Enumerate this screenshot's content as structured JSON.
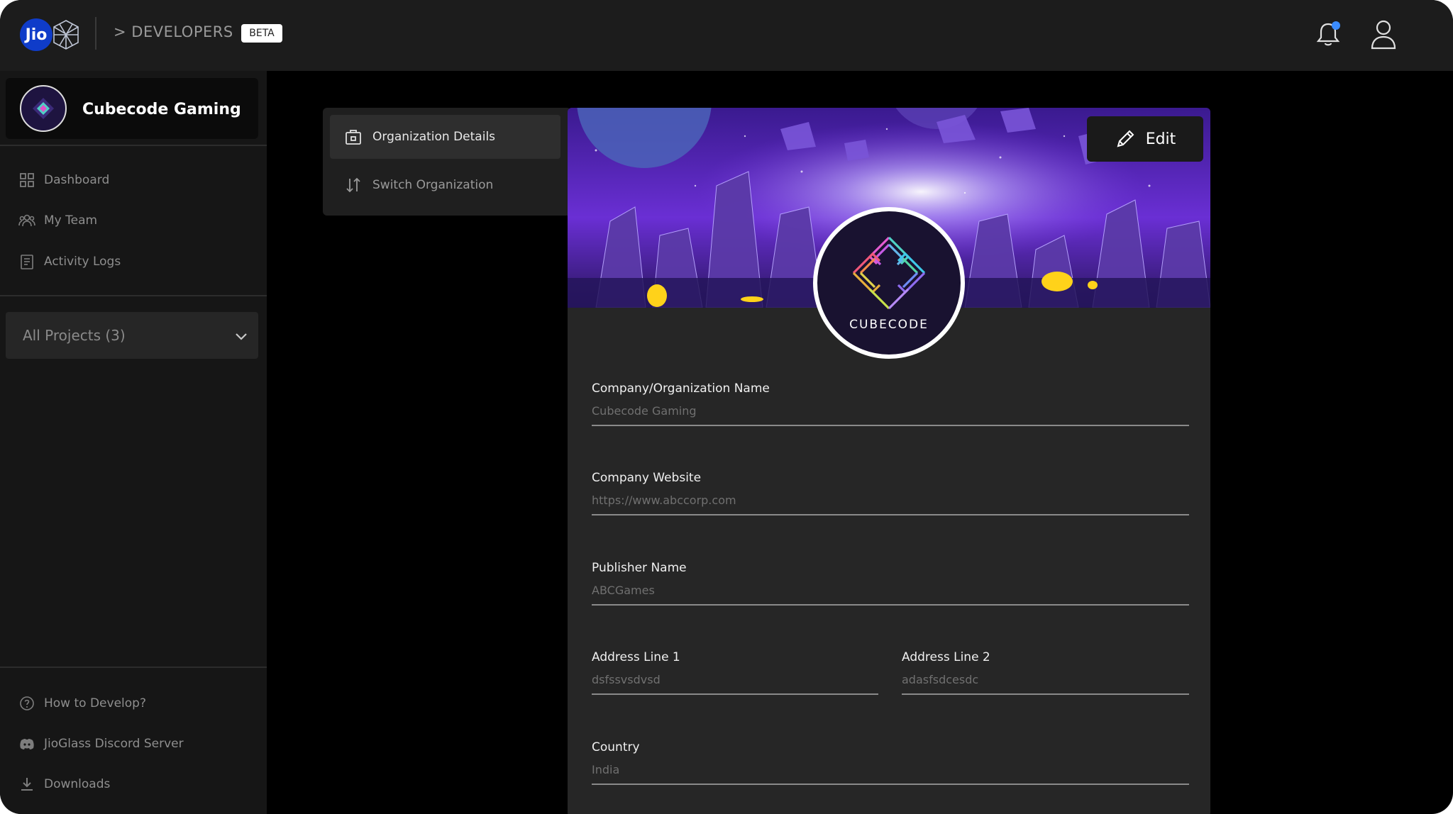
{
  "topbar": {
    "brand_text": "Jio",
    "developers_label": "> DEVELOPERS",
    "beta_label": "BETA"
  },
  "sidebar": {
    "org_name": "Cubecode Gaming",
    "nav_items": [
      {
        "label": "Dashboard",
        "icon": "grid-icon"
      },
      {
        "label": "My Team",
        "icon": "team-icon"
      },
      {
        "label": "Activity Logs",
        "icon": "clipboard-icon"
      }
    ],
    "projects_select": {
      "value": "All Projects (3)"
    },
    "footer_items": [
      {
        "label": "How to Develop?",
        "icon": "help-icon"
      },
      {
        "label": "JioGlass Discord Server",
        "icon": "discord-icon"
      },
      {
        "label": "Downloads",
        "icon": "download-icon"
      }
    ]
  },
  "submenu": {
    "items": [
      {
        "label": "Organization Details",
        "icon": "briefcase-icon",
        "active": true
      },
      {
        "label": "Switch Organization",
        "icon": "swap-icon",
        "active": false
      }
    ]
  },
  "panel": {
    "edit_label": "Edit",
    "logo_wordmark": "CUBECODE",
    "fields": {
      "company_name": {
        "label": "Company/Organization Name",
        "value": "Cubecode Gaming"
      },
      "company_website": {
        "label": "Company Website",
        "value": "https://www.abccorp.com"
      },
      "publisher_name": {
        "label": "Publisher Name",
        "value": "ABCGames"
      },
      "address_line_1": {
        "label": "Address Line 1",
        "value": "dsfssvsdvsd"
      },
      "address_line_2": {
        "label": "Address Line 2",
        "value": "adasfsdcesdc"
      },
      "country": {
        "label": "Country",
        "value": "India"
      }
    }
  },
  "colors": {
    "topbar_bg": "#1c1c1c",
    "sidebar_bg": "#161616",
    "panel_bg": "#262626",
    "jio_blue": "#0f3cc9",
    "notification_dot": "#3b8cff"
  }
}
